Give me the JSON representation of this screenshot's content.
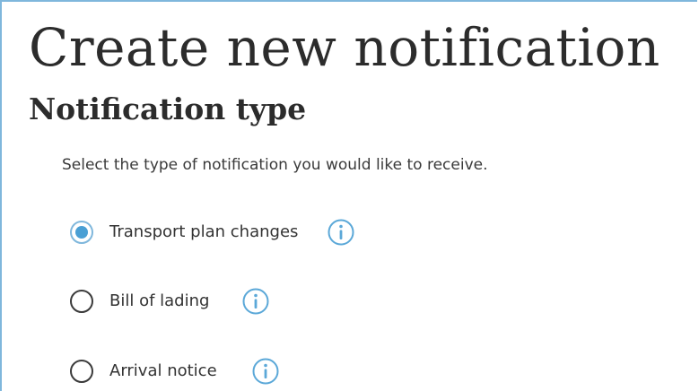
{
  "header": {
    "title": "Create new notification"
  },
  "section": {
    "title": "Notification type",
    "instructions": "Select the type of notification you would like to receive."
  },
  "options": [
    {
      "label": "Transport plan changes",
      "selected": true,
      "info_icon": "info-circle-icon"
    },
    {
      "label": "Bill of lading",
      "selected": false,
      "info_icon": "info-circle-icon"
    },
    {
      "label": "Arrival notice",
      "selected": false,
      "info_icon": "info-circle-icon"
    }
  ],
  "colors": {
    "accent": "#4a9fd4",
    "border": "#7fb7dc",
    "text": "#2c2c2c"
  }
}
